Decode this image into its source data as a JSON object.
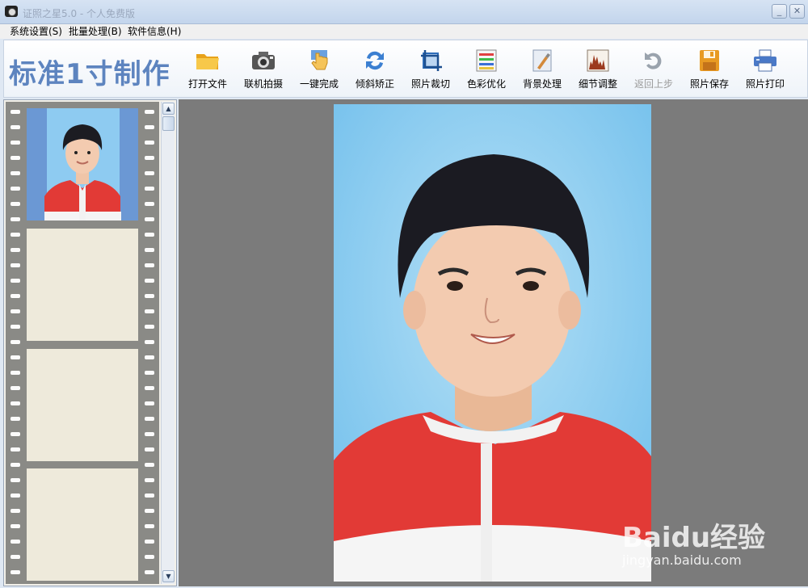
{
  "window": {
    "title": "证照之星5.0 - 个人免费版"
  },
  "menu": [
    {
      "label": "系统设置(S)"
    },
    {
      "label": "批量处理(B)"
    },
    {
      "label": "软件信息(H)"
    }
  ],
  "toolbar": {
    "brand": "标准1寸制作",
    "tools": [
      {
        "label": "打开文件",
        "icon": "folder-icon"
      },
      {
        "label": "联机拍摄",
        "icon": "camera-icon"
      },
      {
        "label": "一键完成",
        "icon": "hand-pointer-icon"
      },
      {
        "label": "倾斜矫正",
        "icon": "rotate-icon"
      },
      {
        "label": "照片裁切",
        "icon": "crop-icon"
      },
      {
        "label": "色彩优化",
        "icon": "color-adjust-icon"
      },
      {
        "label": "背景处理",
        "icon": "brush-icon"
      },
      {
        "label": "细节调整",
        "icon": "histogram-icon"
      },
      {
        "label": "返回上步",
        "icon": "undo-icon",
        "disabled": true
      },
      {
        "label": "照片保存",
        "icon": "save-icon"
      },
      {
        "label": "照片打印",
        "icon": "printer-icon"
      }
    ]
  },
  "watermark": {
    "main": "Baidu经验",
    "sub": "jingyan.baidu.com"
  },
  "colors": {
    "accent": "#5d84bf",
    "canvas": "#7b7b7b",
    "photo_bg": "#86c8ef",
    "jacket": "#e23a36"
  }
}
